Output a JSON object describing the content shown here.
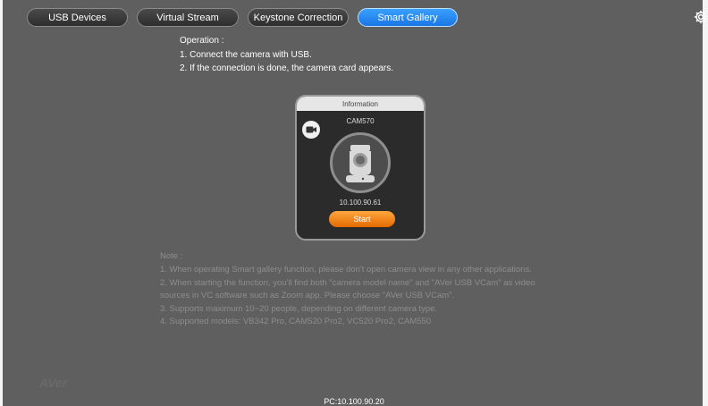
{
  "tabs": [
    {
      "label": "USB Devices",
      "active": false
    },
    {
      "label": "Virtual Stream",
      "active": false
    },
    {
      "label": "Keystone Correction",
      "active": false
    },
    {
      "label": "Smart Gallery",
      "active": true
    }
  ],
  "operation": {
    "title": "Operation :",
    "steps": [
      "1. Connect the camera with USB.",
      "2. If the connection is done, the camera card appears."
    ]
  },
  "card": {
    "header": "Information",
    "model": "CAM570",
    "ip": "10.100.90.61",
    "start_label": "Start"
  },
  "note": {
    "title": "Note :",
    "lines": [
      "1. When operating Smart gallery function, please don't open camera view in any other applications.",
      "2. When starting the function, you'll find both \"camera model name\" and \"AVer USB VCam\" as video",
      "sources in VC software such as Zoom app. Please choose \"AVer USB VCam\".",
      "3. Supports maximum 10~20 people, depending on different camera type.",
      "4. Supported models: VB342 Pro, CAM520 Pro2, VC520 Pro2, CAM550"
    ]
  },
  "footer": {
    "pc_ip": "PC:10.100.90.20",
    "watermark": "AVer"
  },
  "colors": {
    "active_tab": "#1e88f0",
    "start_button": "#f08a14",
    "background": "#5f5f5f"
  },
  "icons": {
    "settings": "gear-icon",
    "camera": "video-camera-icon",
    "ptz": "ptz-camera-icon"
  }
}
